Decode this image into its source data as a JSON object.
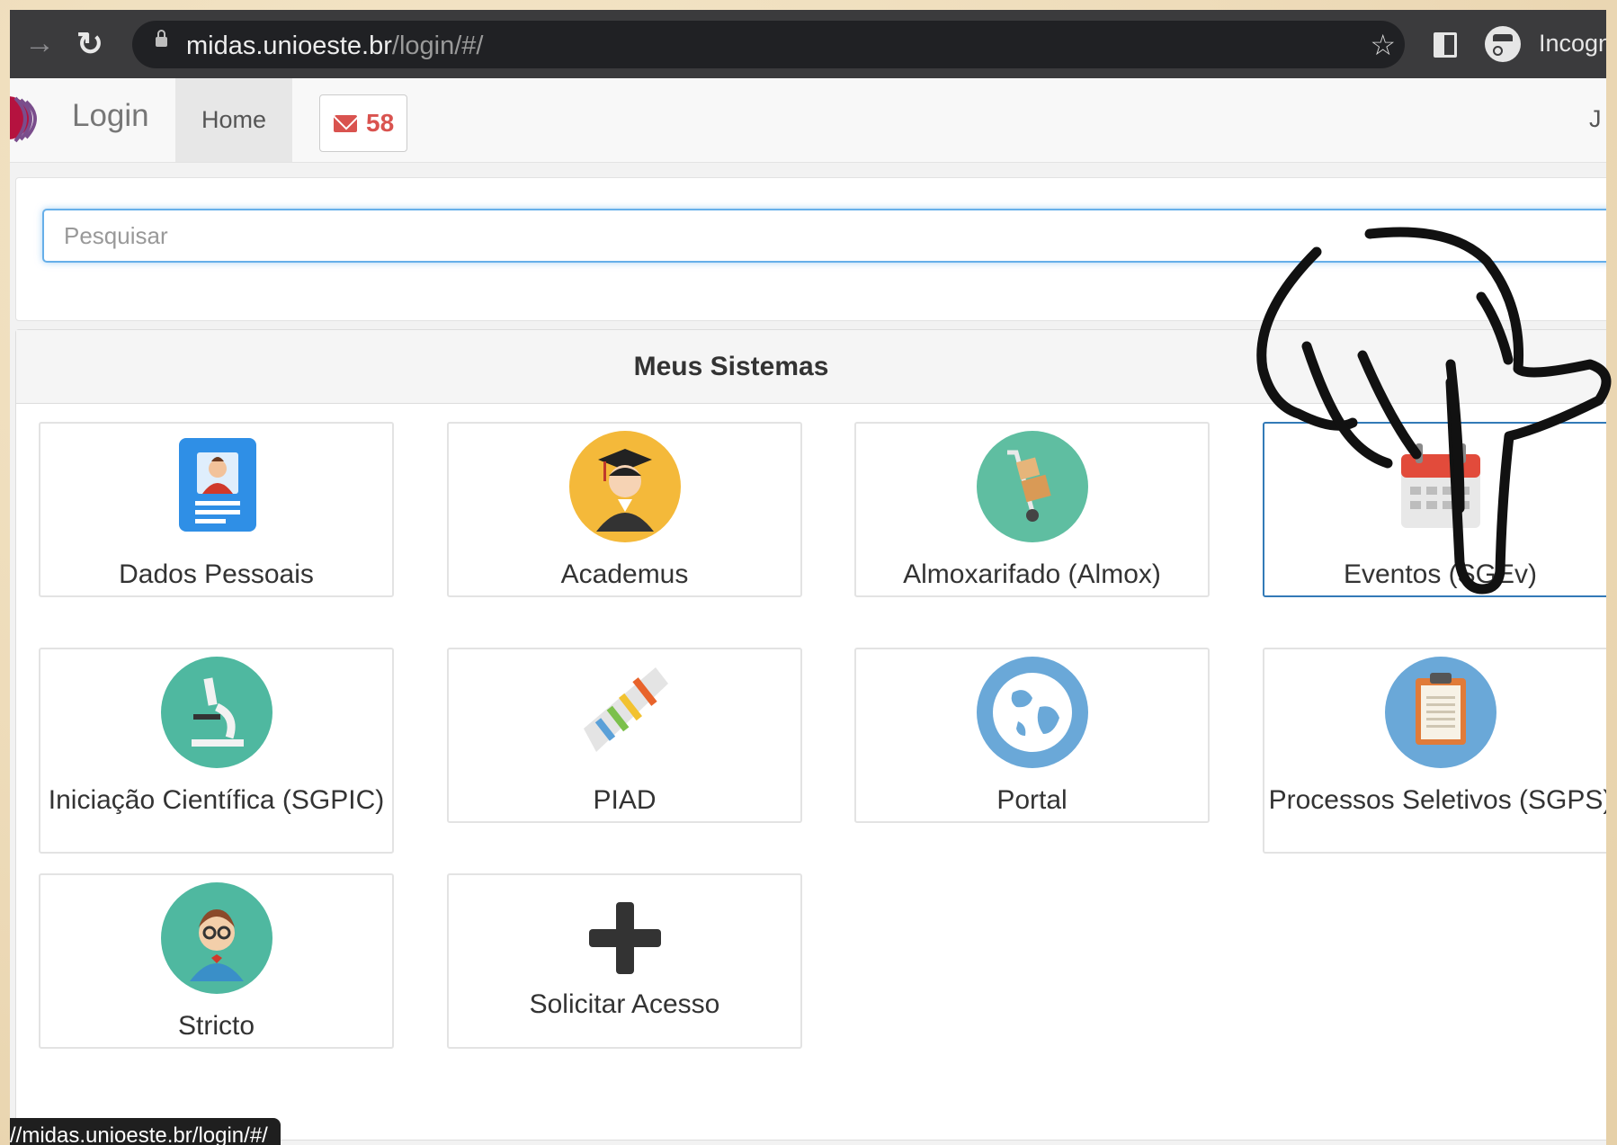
{
  "browser": {
    "url_host": "midas.unioeste.br",
    "url_path": "/login/#/",
    "incognito_label": "Incogni"
  },
  "navbar": {
    "brand": "Login",
    "home": "Home",
    "mail_count": "58",
    "user_initial": "J"
  },
  "search": {
    "placeholder": "Pesquisar"
  },
  "systems": {
    "heading": "Meus Sistemas",
    "tiles": [
      {
        "label": "Dados Pessoais",
        "icon": "id-card-icon"
      },
      {
        "label": "Academus",
        "icon": "graduate-icon"
      },
      {
        "label": "Almoxarifado (Almox)",
        "icon": "hand-truck-icon"
      },
      {
        "label": "Eventos (SGEv)",
        "icon": "calendar-icon"
      },
      {
        "label": "Iniciação Científica (SGPIC)",
        "icon": "microscope-icon"
      },
      {
        "label": "PIAD",
        "icon": "gantt-chart-icon"
      },
      {
        "label": "Portal",
        "icon": "globe-icon"
      },
      {
        "label": "Processos Seletivos (SGPS)",
        "icon": "clipboard-icon"
      },
      {
        "label": "Stricto",
        "icon": "scholar-icon"
      },
      {
        "label": "Solicitar Acesso",
        "icon": "plus-icon"
      }
    ]
  },
  "status_url": "//midas.unioeste.br/login/#/",
  "colors": {
    "accent_blue": "#337ab7",
    "mail_red": "#d9534f",
    "teal": "#4fb8a0",
    "orange": "#f4b93a",
    "globe_blue": "#6aa8d8"
  }
}
